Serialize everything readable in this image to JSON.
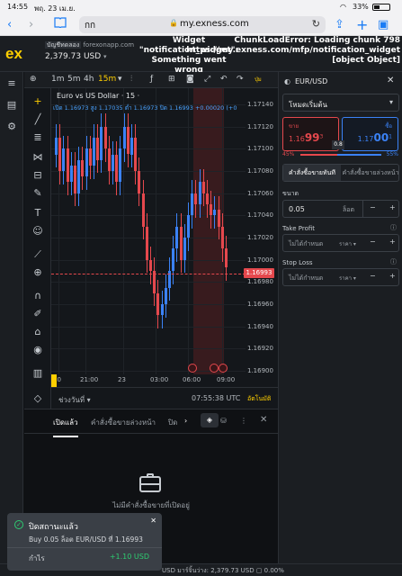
{
  "status": {
    "time": "14:55",
    "date": "พฤ. 23 เม.ย.",
    "battery": "33%"
  },
  "safari": {
    "aa": "กก",
    "url": "my.exness.com",
    "lock": "🔒"
  },
  "header": {
    "account_tag": "บัญชีทดลอง",
    "domain": "forexonapp.com",
    "balance": "2,379.73 USD",
    "error_mid_1": "Widget",
    "error_mid_2": "\"notification_widget\":",
    "error_mid_3": "Something went",
    "error_mid_4": "wrong",
    "error_right_1": "ChunkLoadError: Loading chunk 798",
    "error_right_2": "https://my.exness.com/mfp/notification_widget",
    "error_right_3": "[object Object]"
  },
  "toolbar": {
    "tf1": "1m",
    "tf2": "5m",
    "tf3": "4h",
    "tf4": "15m",
    "more": "ปุ่ม"
  },
  "chart": {
    "title": "Euro vs US Dollar · 15 ·",
    "ohlc": "เปิด 1.16973  สูง 1.17035  ต่ำ 1.16973  ปิด 1.16993  +0.00020 (+0",
    "current_price": "1.16993",
    "time_label": "07:55:38 UTC",
    "auto_label": "อัตโนมัติ",
    "range_label": "ช่วงวันที่"
  },
  "chart_data": {
    "type": "line",
    "yticks": [
      "1.17140",
      "1.17120",
      "1.17100",
      "1.17080",
      "1.17060",
      "1.17040",
      "1.17020",
      "1.17000",
      "1.16980",
      "1.16960",
      "1.16940",
      "1.16920",
      "1.16900"
    ],
    "xticks": [
      "00",
      "21:00",
      "23",
      "03:00",
      "06:00",
      "09:00"
    ],
    "ylim": [
      1.169,
      1.1714
    ]
  },
  "bottom": {
    "tab_open": "เปิดแล้ว",
    "tab_pending": "คำสั่งซื้อขายล่วงหน้า",
    "tab_closed": "ปิด",
    "empty": "ไม่มีคำสั่งซื้อขายที่เปิดอยู่"
  },
  "right": {
    "symbol": "EUR/USD",
    "mode": "โหมดเริ่มต้น",
    "sell_label": "ขาย",
    "sell_price_a": "1.16",
    "sell_price_b": "99",
    "sell_price_c": "3",
    "buy_label": "ซื้อ",
    "buy_price_a": "1.17",
    "buy_price_b": "00",
    "buy_price_c": "1",
    "spread": "0.8",
    "pct_sell": "45%",
    "pct_buy": "55%",
    "pct_sell_value": 45,
    "order_market": "คำสั่งซื้อขายทันที",
    "order_pending": "คำสั่งซื้อขายล่วงหน้า",
    "volume_label": "ขนาด",
    "volume_value": "0.05",
    "volume_unit": "ล็อต",
    "tp_label": "Take Profit",
    "tp_value": "ไม่ได้กำหนด",
    "tp_unit": "ราคา",
    "sl_label": "Stop Loss",
    "sl_value": "ไม่ได้กำหนด",
    "sl_unit": "ราคา"
  },
  "toast": {
    "title": "ปิดสถานะแล้ว",
    "detail": "Buy 0.05 ล็อต EUR/USD ที่ 1.16993",
    "profit_label": "กำไร",
    "profit_value": "+1.10 USD"
  },
  "footer": {
    "text": "USD   มาร์จิ้นว่าง: 2,379.73 USD   ▢ 0.00%"
  }
}
